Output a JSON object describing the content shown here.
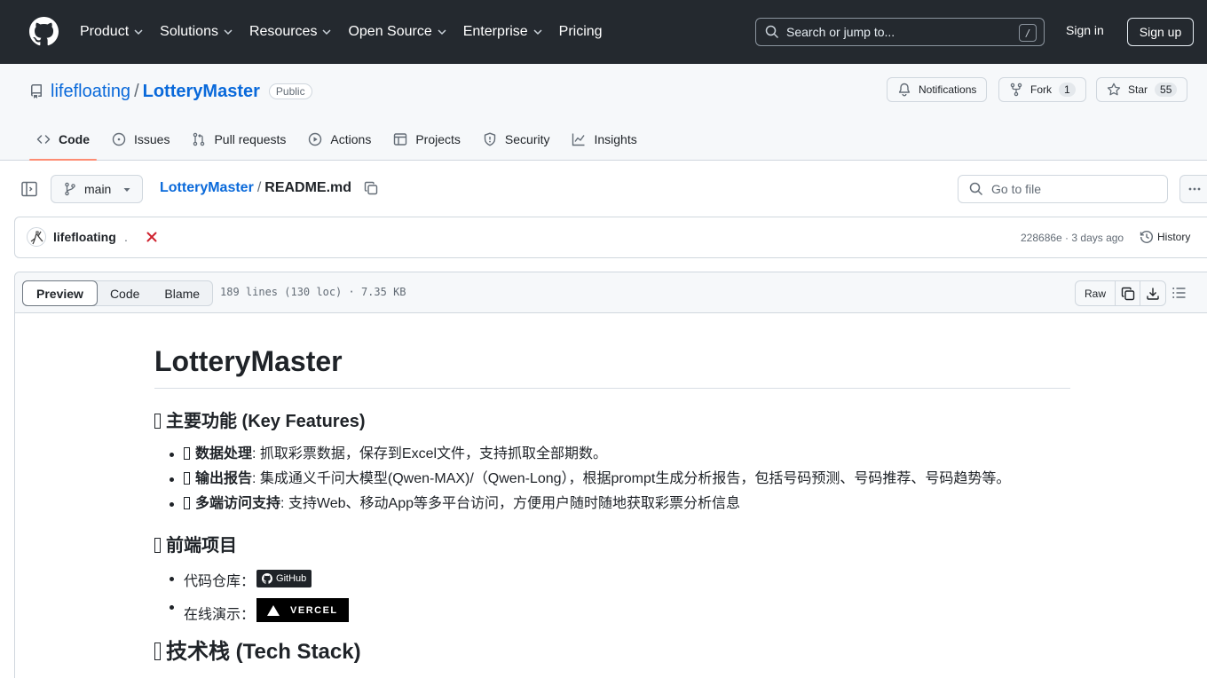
{
  "header": {
    "nav": [
      {
        "label": "Product"
      },
      {
        "label": "Solutions"
      },
      {
        "label": "Resources"
      },
      {
        "label": "Open Source"
      },
      {
        "label": "Enterprise"
      },
      {
        "label": "Pricing"
      }
    ],
    "search_placeholder": "Search or jump to...",
    "search_shortcut": "/",
    "sign_in": "Sign in",
    "sign_up": "Sign up"
  },
  "repo": {
    "owner": "lifefloating",
    "separator": "/",
    "name": "LotteryMaster",
    "visibility": "Public",
    "notifications_label": "Notifications",
    "fork_label": "Fork",
    "fork_count": "1",
    "star_label": "Star",
    "star_count": "55",
    "tabs": [
      {
        "label": "Code",
        "icon": "code-icon"
      },
      {
        "label": "Issues",
        "icon": "issue-icon"
      },
      {
        "label": "Pull requests",
        "icon": "pull-request-icon"
      },
      {
        "label": "Actions",
        "icon": "play-icon"
      },
      {
        "label": "Projects",
        "icon": "table-icon"
      },
      {
        "label": "Security",
        "icon": "shield-icon"
      },
      {
        "label": "Insights",
        "icon": "graph-icon"
      }
    ]
  },
  "file_nav": {
    "branch": "main",
    "crumb_repo": "LotteryMaster",
    "crumb_sep": "/",
    "crumb_file": "README.md",
    "goto_placeholder": "Go to file"
  },
  "commit": {
    "author": "lifefloating",
    "message": ".",
    "meta": "228686e · 3 days ago",
    "history_label": "History",
    "status_color": "#cf222e"
  },
  "file": {
    "tabs": [
      "Preview",
      "Code",
      "Blame"
    ],
    "info": "189 lines (130 loc) · 7.35 KB",
    "raw_label": "Raw"
  },
  "readme": {
    "title": "LotteryMaster",
    "features_heading": "主要功能 (Key Features)",
    "features": [
      {
        "bold": "数据处理",
        "text": ": 抓取彩票数据，保存到Excel文件，支持抓取全部期数。"
      },
      {
        "bold": "输出报告",
        "text": ": 集成通义千问大模型(Qwen-MAX)/（Qwen-Long），根据prompt生成分析报告，包括号码预测、号码推荐、号码趋势等。"
      },
      {
        "bold": "多端访问支持",
        "text": ": 支持Web、移动App等多平台访问，方便用户随时随地获取彩票分析信息"
      }
    ],
    "frontend_heading": "前端项目",
    "repo_label": "代码仓库：",
    "repo_badge": "GitHub",
    "demo_label": "在线演示：",
    "demo_badge": "VERCEL",
    "tech_heading": "技术栈 (Tech Stack)"
  },
  "colors": {
    "header_bg": "#24292f",
    "link": "#0969da",
    "tab_underline": "#fd8c73",
    "border": "#d0d7de"
  }
}
